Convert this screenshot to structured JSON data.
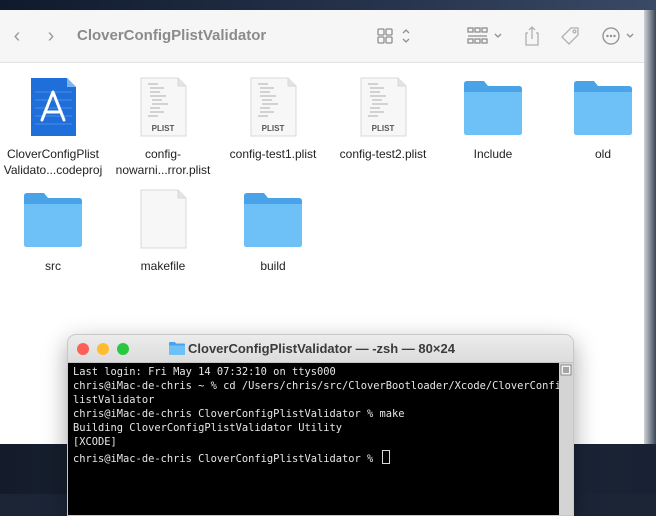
{
  "finder": {
    "title": "CloverConfigPlistValidator",
    "toolbar": {
      "back_icon": "chevron-left-icon",
      "forward_icon": "chevron-right-icon",
      "view_icon": "grid-view-icon",
      "group_icon": "group-icon",
      "share_icon": "share-icon",
      "tag_icon": "tag-icon",
      "more_icon": "ellipsis-circle-icon"
    },
    "items": [
      {
        "line1": "CloverConfigPlist",
        "line2": "Validato...codeproj",
        "kind": "xcodeproj"
      },
      {
        "line1": "config-",
        "line2": "nowarni...rror.plist",
        "kind": "plist",
        "badge": "PLIST"
      },
      {
        "line1": "config-test1.plist",
        "line2": "",
        "kind": "plist",
        "badge": "PLIST"
      },
      {
        "line1": "config-test2.plist",
        "line2": "",
        "kind": "plist",
        "badge": "PLIST"
      },
      {
        "line1": "Include",
        "line2": "",
        "kind": "folder"
      },
      {
        "line1": "old",
        "line2": "",
        "kind": "folder"
      },
      {
        "line1": "src",
        "line2": "",
        "kind": "folder"
      },
      {
        "line1": "makefile",
        "line2": "",
        "kind": "document"
      },
      {
        "line1": "build",
        "line2": "",
        "kind": "folder"
      }
    ]
  },
  "terminal": {
    "title": "CloverConfigPlistValidator — -zsh — 80×24",
    "folder_icon": "folder-icon",
    "colors": {
      "close": "#fe5f57",
      "minimize": "#febc2e",
      "zoom": "#28c840"
    },
    "lines": [
      "Last login: Fri May 14 07:32:10 on ttys000",
      "chris@iMac-de-chris ~ % cd /Users/chris/src/CloverBootloader/Xcode/CloverConfigP",
      "listValidator",
      "chris@iMac-de-chris CloverConfigPlistValidator % make",
      "Building CloverConfigPlistValidator Utility",
      "[XCODE]",
      "chris@iMac-de-chris CloverConfigPlistValidator % "
    ]
  }
}
